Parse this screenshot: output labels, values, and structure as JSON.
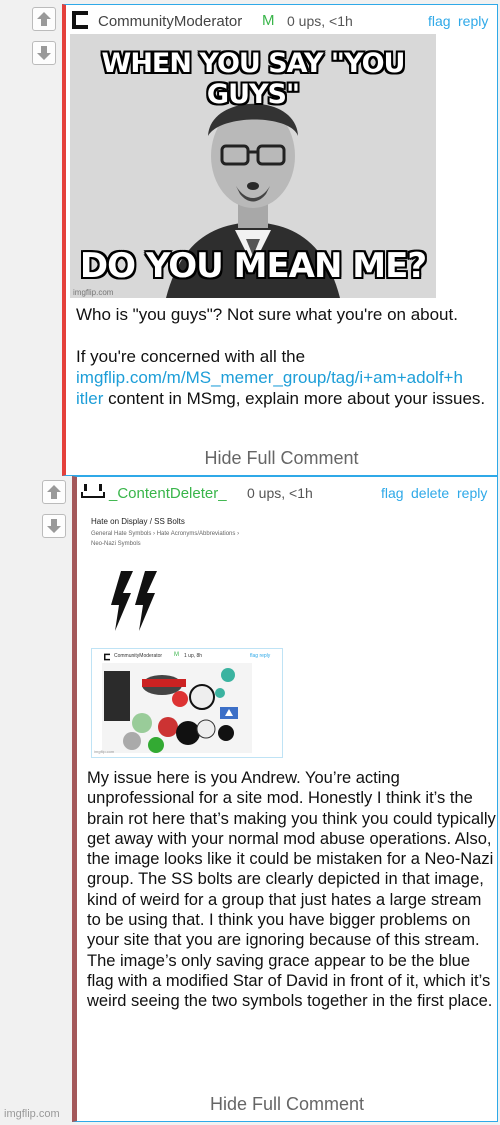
{
  "comment1": {
    "username": "CommunityModerator",
    "mod_badge": "M",
    "meta": "0 ups, <1h",
    "actions": {
      "flag": "flag",
      "reply": "reply"
    },
    "meme": {
      "top_text": "WHEN YOU SAY \"YOU GUYS\"",
      "bottom_text": "DO YOU MEAN ME?",
      "watermark": "imgflip.com"
    },
    "text_p1": "Who is \"you guys\"? Not sure what you're on about.",
    "text_p2_before": "If you're concerned with all the",
    "link_line1": "imgflip.com/m/MS_memer_group/tag/i+am+adolf+h",
    "link_line2": "itler",
    "text_p2_after": " content in MSmg, explain more about your issues.",
    "hide_label": "Hide Full Comment"
  },
  "comment2": {
    "username": "_ContentDeleter_",
    "meta": "0 ups, <1h",
    "actions": {
      "flag": "flag",
      "delete": "delete",
      "reply": "reply"
    },
    "screenshot": {
      "title": "Hate on Display / SS Bolts",
      "breadcrumb": "General Hate Symbols › Hate Acronyms/Abbreviations ›",
      "breadcrumb2": "Neo-Nazi Symbols",
      "inner_user": "CommunityModerator",
      "inner_badge": "M",
      "inner_meta": "1 up, 8h",
      "inner_actions": "flag reply",
      "inner_watermark": "imgflip.com"
    },
    "text": "My issue here is you Andrew. You’re acting unprofessional for a site mod. Honestly I think it’s the brain rot here that’s making you think you could typically get away with your normal mod abuse operations. Also, the image looks like it could be mistaken for a Neo-Nazi group. The SS bolts are clearly depicted in that image, kind of weird for a group that just hates a large stream to be using that. I think you have bigger problems on your site that you are ignoring because of this stream. The image’s only saving grace appear to be the blue flag with a modified Star of David in front of it, which it’s weird seeing the two symbols together in the first place.",
    "hide_label": "Hide Full Comment"
  },
  "page_watermark": "imgflip.com",
  "colors": {
    "link": "#2fa9e8",
    "mod_green": "#39b54a",
    "border_red": "#e4403b",
    "border_brown": "#a4585a"
  }
}
